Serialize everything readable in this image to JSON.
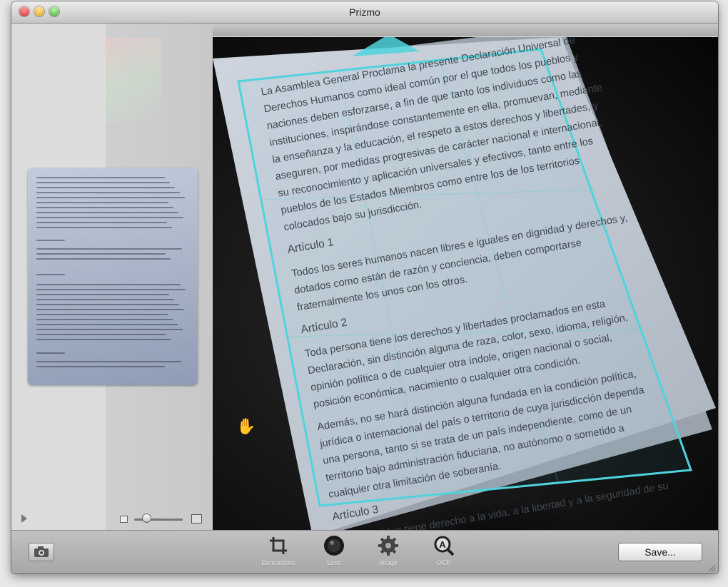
{
  "window": {
    "title": "Prizmo"
  },
  "toolbar": {
    "tools": [
      {
        "label": "Dimensions",
        "icon": "crop-icon"
      },
      {
        "label": "Lens",
        "icon": "lens-icon"
      },
      {
        "label": "Image",
        "icon": "gear-icon"
      },
      {
        "label": "OCR",
        "icon": "ocr-magnifier-icon"
      }
    ],
    "save_label": "Save..."
  },
  "document": {
    "paragraph1": "La Asamblea General Proclama la presente Declaración Universal de Derechos Humanos como ideal común por el que todos los pueblos y naciones deben esforzarse, a fin de que tanto los individuos como las instituciones, inspirándose constantemente en ella, promuevan, mediante la enseñanza y la educación, el respeto a estos derechos y libertades, y aseguren, por medidas progresivas de carácter nacional e internacional, su reconocimiento y aplicación universales y efectivos, tanto entre los pueblos de los Estados Miembros como entre los de los territorios colocados bajo su jurisdicción.",
    "heading1": "Artículo 1",
    "paragraph2": "Todos los seres humanos nacen libres e iguales en dignidad y derechos y, dotados como están de razón y conciencia, deben comportarse fraternalmente los unos con los otros.",
    "heading2": "Artículo 2",
    "paragraph3": "Toda persona tiene los derechos y libertades proclamados en esta Declaración, sin distinción alguna de raza, color, sexo, idioma, religión, opinión política o de cualquier otra índole, origen nacional o social, posición económica, nacimiento o cualquier otra condición.",
    "paragraph4": "Además, no se hará distinción alguna fundada en la condición política, jurídica o internacional del país o territorio de cuya jurisdicción dependa una persona, tanto si se trata de un país independiente, como de un territorio bajo administración fiduciaria, no autónomo o sometido a cualquier otra limitación de soberanía.",
    "heading3": "Artículo 3",
    "paragraph5": "Todo individuo tiene derecho a la vida, a la libertad y a la seguridad de su persona."
  },
  "colors": {
    "crop_frame": "#4fd3dd",
    "paper": "#c5ccd6",
    "background": "#111111"
  }
}
